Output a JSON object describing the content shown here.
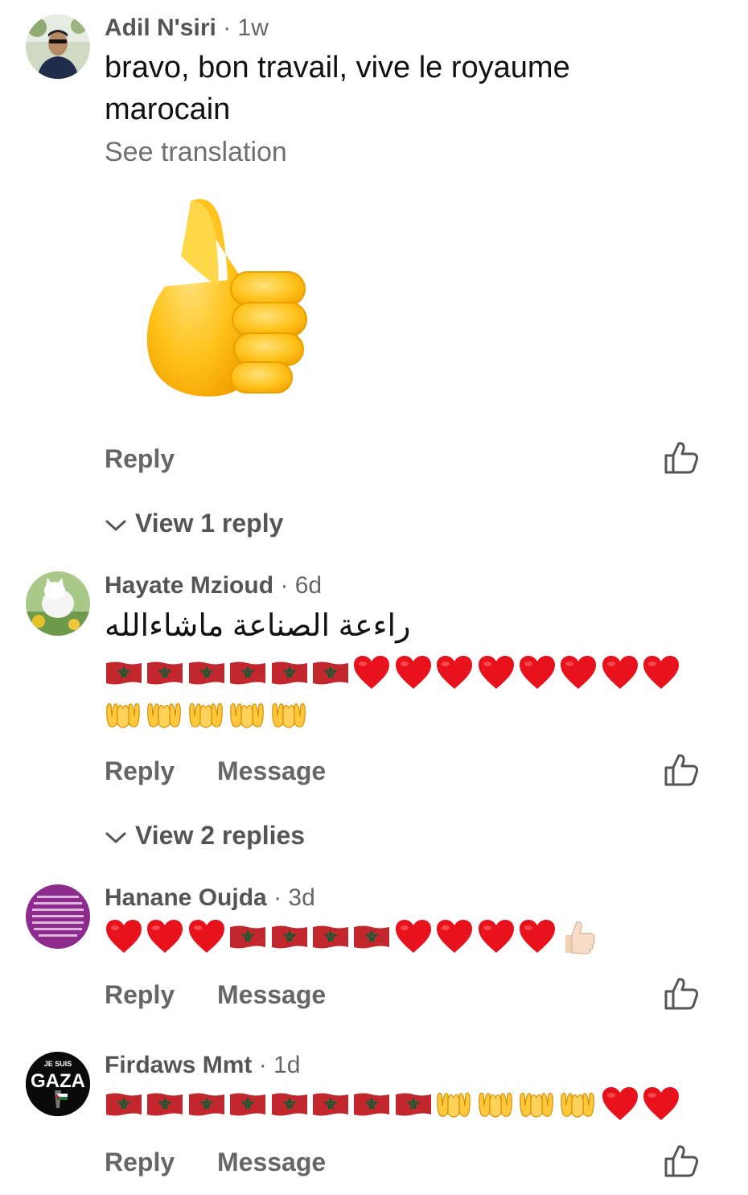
{
  "comments": [
    {
      "author": "Adil N'siri",
      "time": "1w",
      "text": "bravo, bon travail, vive le royaume marocain",
      "see_translation": "See translation",
      "sticker": "thumbs-up-sticker",
      "actions": {
        "reply": "Reply"
      },
      "view_replies": "View 1 reply"
    },
    {
      "author": "Hayate Mzioud",
      "time": "6d",
      "text": "راءعة الصناعة ماشاءالله",
      "emoji_line1": [
        "morocco-flag",
        "morocco-flag",
        "morocco-flag",
        "morocco-flag",
        "morocco-flag",
        "morocco-flag",
        "red-heart",
        "red-heart",
        "red-heart",
        "red-heart",
        "red-heart",
        "red-heart",
        "red-heart",
        "red-heart"
      ],
      "emoji_line2": [
        "palms-up-hands",
        "palms-up-hands",
        "palms-up-hands",
        "palms-up-hands",
        "palms-up-hands"
      ],
      "actions": {
        "reply": "Reply",
        "message": "Message"
      },
      "view_replies": "View 2 replies"
    },
    {
      "author": "Hanane Oujda",
      "time": "3d",
      "emoji_line1": [
        "red-heart",
        "red-heart",
        "red-heart",
        "morocco-flag",
        "morocco-flag",
        "morocco-flag",
        "morocco-flag",
        "red-heart",
        "red-heart",
        "red-heart",
        "red-heart",
        "thumbs-up-light"
      ],
      "actions": {
        "reply": "Reply",
        "message": "Message"
      }
    },
    {
      "author": "Firdaws Mmt",
      "time": "1d",
      "avatar_text": [
        "JE SUIS",
        "GAZA"
      ],
      "emoji_line1": [
        "morocco-flag",
        "morocco-flag",
        "morocco-flag",
        "morocco-flag",
        "morocco-flag",
        "morocco-flag",
        "morocco-flag",
        "morocco-flag",
        "palms-up-hands",
        "palms-up-hands",
        "palms-up-hands",
        "palms-up-hands",
        "red-heart",
        "red-heart"
      ],
      "actions": {
        "reply": "Reply",
        "message": "Message"
      }
    }
  ],
  "separator": "·",
  "colors": {
    "accent_gray": "#666666",
    "name_gray": "#555555",
    "flag_red": "#c1272d",
    "flag_green": "#006233",
    "heart_red": "#e8121d"
  }
}
